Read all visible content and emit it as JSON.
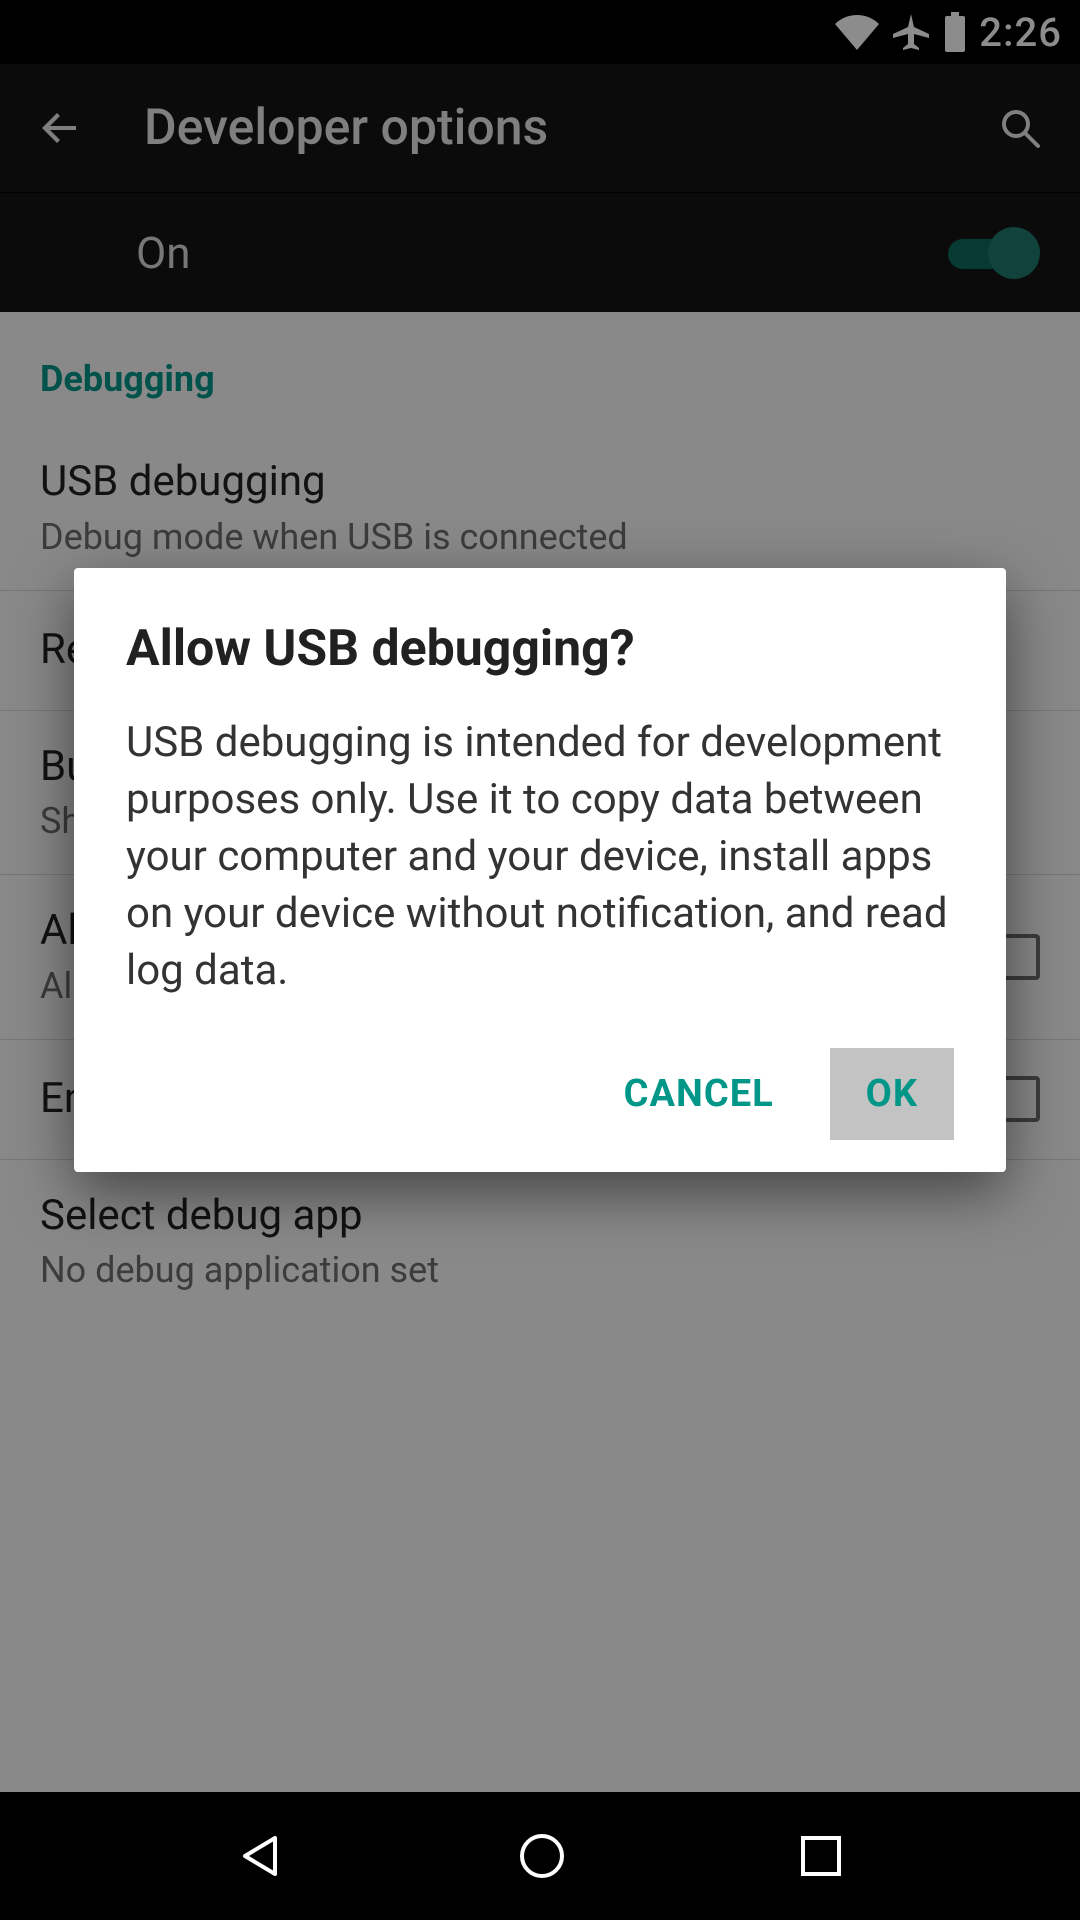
{
  "status": {
    "time": "2:26"
  },
  "appbar": {
    "title": "Developer options"
  },
  "master": {
    "label": "On",
    "on": true
  },
  "section": {
    "debugging_header": "Debugging"
  },
  "rows": {
    "usb": {
      "title": "USB debugging",
      "sub": "Debug mode when USB is connected"
    },
    "revoke": {
      "title": "Revoke USB debugging authorizations"
    },
    "bugreport": {
      "title": "Bug report shortcut",
      "sub": "Show a button in the power menu for taking a bug report"
    },
    "mock": {
      "title": "Allow mock locations",
      "sub": "Allow mock locations"
    },
    "viewattr": {
      "title": "Enable view attribute inspection"
    },
    "selectdebug": {
      "title": "Select debug app",
      "sub": "No debug application set"
    }
  },
  "dialog": {
    "title": "Allow USB debugging?",
    "body": "USB debugging is intended for development purposes only. Use it to copy data between your computer and your device, install apps on your device without notification, and read log data.",
    "cancel": "CANCEL",
    "ok": "OK"
  },
  "colors": {
    "accent": "#009688"
  }
}
